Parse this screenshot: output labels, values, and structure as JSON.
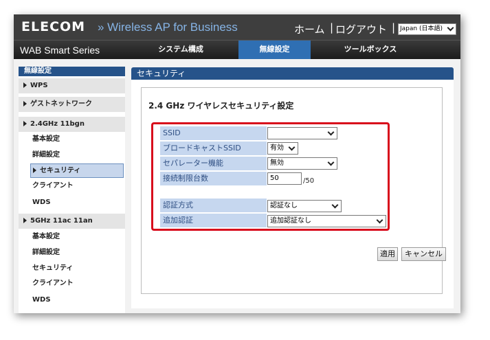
{
  "header": {
    "logo": "ELECOM",
    "product": "» Wireless AP for Business",
    "home": "ホーム",
    "separator": "|",
    "logout": "ログアウト",
    "language": "Japan (日本語)"
  },
  "nav": {
    "series": "WAB Smart Series",
    "tabs": [
      "システム構成",
      "無線設定",
      "ツールボックス"
    ],
    "active_tab": "無線設定"
  },
  "sidebar": {
    "title": "無線設定",
    "groups": [
      {
        "label": "WPS"
      },
      {
        "label": "ゲストネットワーク"
      },
      {
        "label": "2.4GHz 11bgn",
        "items": [
          "基本設定",
          "詳細設定",
          "セキュリティ",
          "クライアント",
          "WDS"
        ]
      },
      {
        "label": "5GHz 11ac 11an",
        "items": [
          "基本設定",
          "詳細設定",
          "セキュリティ",
          "クライアント",
          "WDS"
        ]
      }
    ],
    "active_item": "セキュリティ"
  },
  "content": {
    "title": "セキュリティ",
    "section_title": "2.4 GHz ワイヤレスセキュリティ設定",
    "fields": {
      "ssid": {
        "label": "SSID",
        "value": ""
      },
      "broadcast_ssid": {
        "label": "ブロードキャストSSID",
        "value": "有効"
      },
      "separator": {
        "label": "セパレーター機能",
        "value": "無効"
      },
      "max_clients": {
        "label": "接続制限台数",
        "value": "50",
        "unit": "/50"
      },
      "auth_method": {
        "label": "認証方式",
        "value": "認証なし"
      },
      "additional_auth": {
        "label": "追加認証",
        "value": "追加認証なし"
      }
    },
    "buttons": {
      "apply": "適用",
      "cancel": "キャンセル"
    }
  },
  "colors": {
    "header_bg": "#3e3e3e",
    "product_text": "#86b4e6",
    "nav_active": "#2f6fb3",
    "panel_header": "#26538a",
    "label_bg": "#c6d7ef",
    "highlight_border": "#d8091b"
  },
  "icons": {
    "dropdown": "chevron-down-icon",
    "sidebar_arrow": "caret-right-icon"
  }
}
